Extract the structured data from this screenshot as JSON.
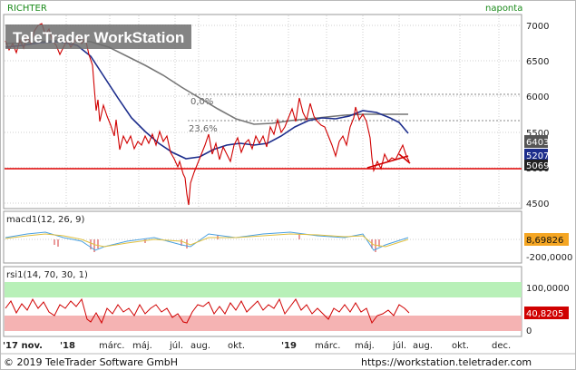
{
  "header": {
    "symbol": "RICHTER",
    "period": "naponta"
  },
  "watermark": "TeleTrader WorkStation",
  "price_panel": {
    "axis_ticks": [
      "7000",
      "6500",
      "6000",
      "5500",
      "5000",
      "4500"
    ],
    "fib_levels": [
      "0,0%",
      "23,6%"
    ],
    "tags": [
      "6403",
      "5207",
      "5069"
    ]
  },
  "macd_panel": {
    "label": "macd1(12, 26, 9)",
    "tag": "8,69826",
    "ticks": [
      "0",
      "-200,0000"
    ]
  },
  "rsi_panel": {
    "label": "rsi1(14, 70, 30, 1)",
    "tag": "40,8205",
    "ticks": [
      "100,0000",
      "0"
    ]
  },
  "time_axis": [
    "'17 nov.",
    "'18",
    "márc.",
    "máj.",
    "júl.",
    "aug.",
    "okt.",
    "'19",
    "márc.",
    "máj.",
    "júl.",
    "aug.",
    "okt.",
    "dec."
  ],
  "footer": {
    "copyright": "© 2019 TeleTrader Software GmbH",
    "url": "https://workstation.teletrader.com"
  },
  "colors": {
    "price": "#d00000",
    "ma_fast": "#1c2d8c",
    "ma_slow": "#777777",
    "support": "#e00000",
    "rsi_overbought": "#b8f0b8",
    "rsi_oversold": "#f5b3b3"
  }
}
